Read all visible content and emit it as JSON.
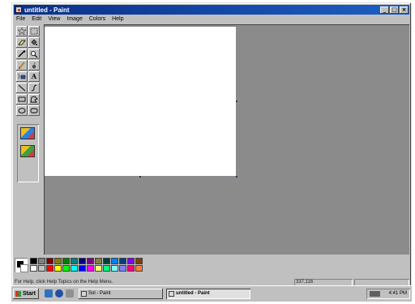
{
  "window": {
    "title": "untitled - Paint",
    "controls": {
      "minimize": "_",
      "maximize": "□",
      "close": "×"
    }
  },
  "menubar": {
    "items": [
      "File",
      "Edit",
      "View",
      "Image",
      "Colors",
      "Help"
    ]
  },
  "toolbox": {
    "tools": [
      {
        "name": "free-form-select",
        "icon": "star-select-icon"
      },
      {
        "name": "rect-select",
        "icon": "dashed-rect-icon"
      },
      {
        "name": "eraser",
        "icon": "eraser-icon"
      },
      {
        "name": "fill",
        "icon": "paint-bucket-icon"
      },
      {
        "name": "pick-color",
        "icon": "eyedropper-icon"
      },
      {
        "name": "magnifier",
        "icon": "magnifier-icon"
      },
      {
        "name": "pencil",
        "icon": "pencil-icon"
      },
      {
        "name": "brush",
        "icon": "brush-icon"
      },
      {
        "name": "airbrush",
        "icon": "airbrush-icon"
      },
      {
        "name": "text",
        "icon": "text-icon",
        "glyph": "A"
      },
      {
        "name": "line",
        "icon": "line-icon"
      },
      {
        "name": "curve",
        "icon": "curve-icon"
      },
      {
        "name": "rectangle",
        "icon": "rectangle-icon"
      },
      {
        "name": "polygon",
        "icon": "polygon-icon"
      },
      {
        "name": "ellipse",
        "icon": "ellipse-icon"
      },
      {
        "name": "rounded-rect",
        "icon": "rounded-rect-icon"
      }
    ],
    "options": [
      "opaque-option-icon",
      "transparent-option-icon"
    ]
  },
  "palette": {
    "foreground": "#000000",
    "background": "#ffffff",
    "row1": [
      "#000000",
      "#808080",
      "#800000",
      "#808000",
      "#008000",
      "#008080",
      "#000080",
      "#800080",
      "#808040",
      "#004040",
      "#0080ff",
      "#004080",
      "#8000ff",
      "#804000"
    ],
    "row2": [
      "#ffffff",
      "#c0c0c0",
      "#ff0000",
      "#ffff00",
      "#00ff00",
      "#00ffff",
      "#0000ff",
      "#ff00ff",
      "#ffff80",
      "#00ff80",
      "#80ffff",
      "#8080ff",
      "#ff0080",
      "#ff8040"
    ]
  },
  "statusbar": {
    "help": "For Help, click Help Topics on the Help Menu.",
    "coords": "337,116"
  },
  "taskbar": {
    "start": "Start",
    "tasks": [
      "Sol - Paint",
      "untitled - Paint"
    ],
    "clock": "4:41 PM"
  },
  "colors": {
    "title_start": "#0a2f86",
    "title_end": "#1d5fc4",
    "workspace": "#8b8b8b",
    "face": "#c0c0c0"
  }
}
